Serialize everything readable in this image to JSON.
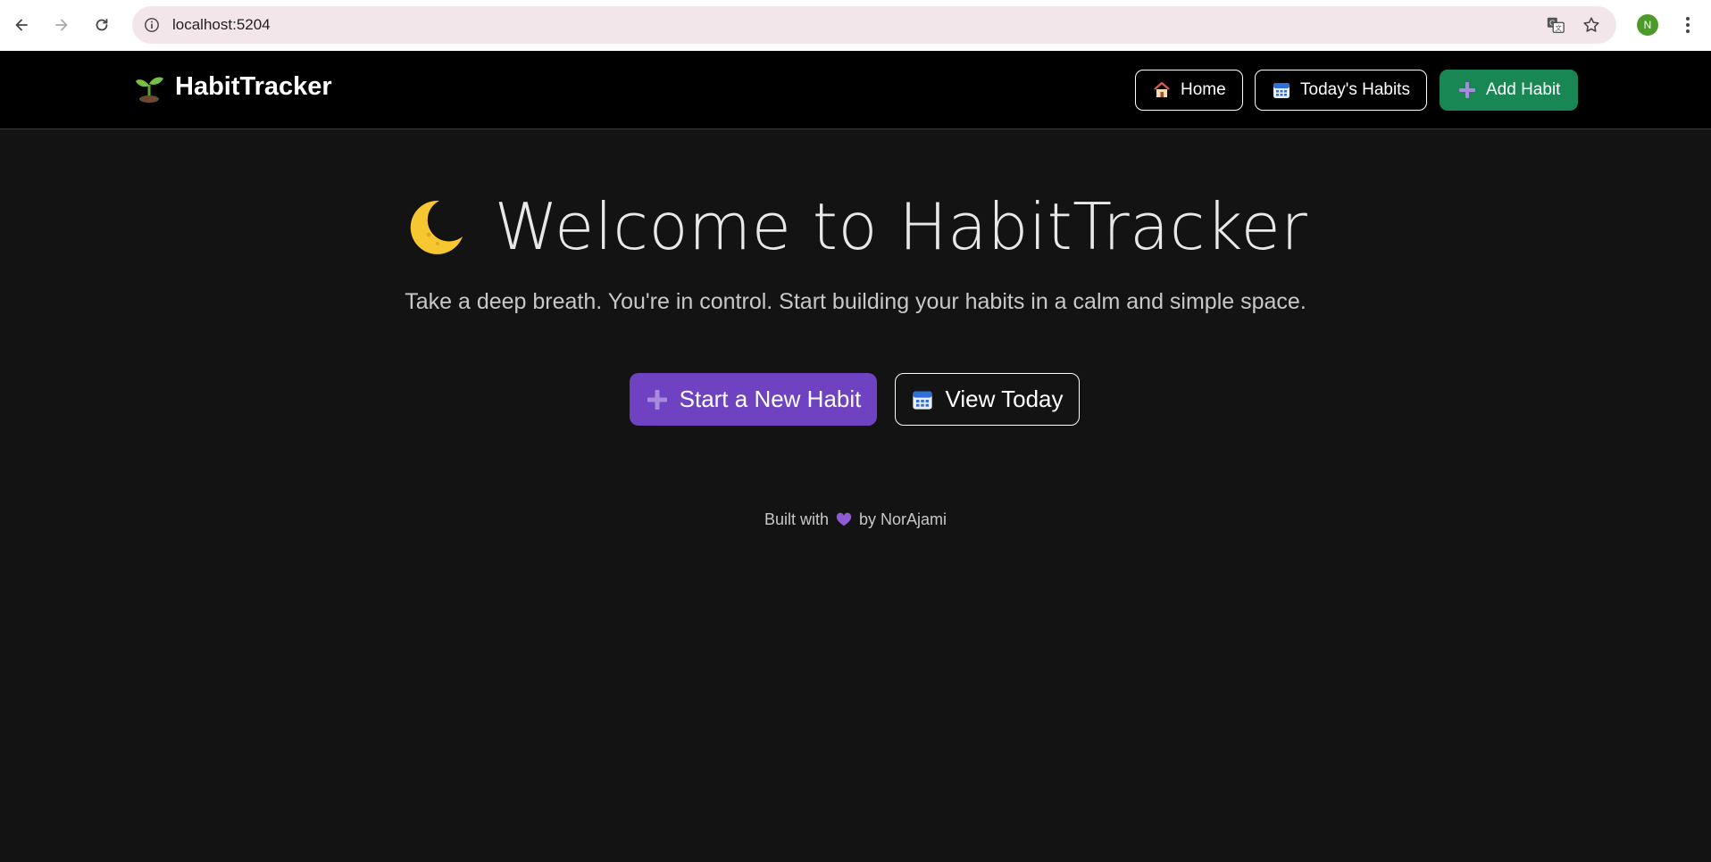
{
  "browser": {
    "url": "localhost:5204",
    "profile_initial": "N"
  },
  "navbar": {
    "brand": "HabitTracker",
    "links": [
      {
        "label": "Home",
        "icon": "house-icon"
      },
      {
        "label": "Today's Habits",
        "icon": "calendar-icon"
      },
      {
        "label": "Add Habit",
        "icon": "plus-icon"
      }
    ],
    "add_color": "#198754"
  },
  "hero": {
    "title": "Welcome to HabitTracker",
    "subtitle": "Take a deep breath. You're in control. Start building your habits in a calm and simple space.",
    "primary_button": "Start a New Habit",
    "secondary_button": "View Today",
    "primary_color": "#6f42c1"
  },
  "footer": {
    "prefix": "Built with",
    "suffix": "by NorAjami"
  }
}
